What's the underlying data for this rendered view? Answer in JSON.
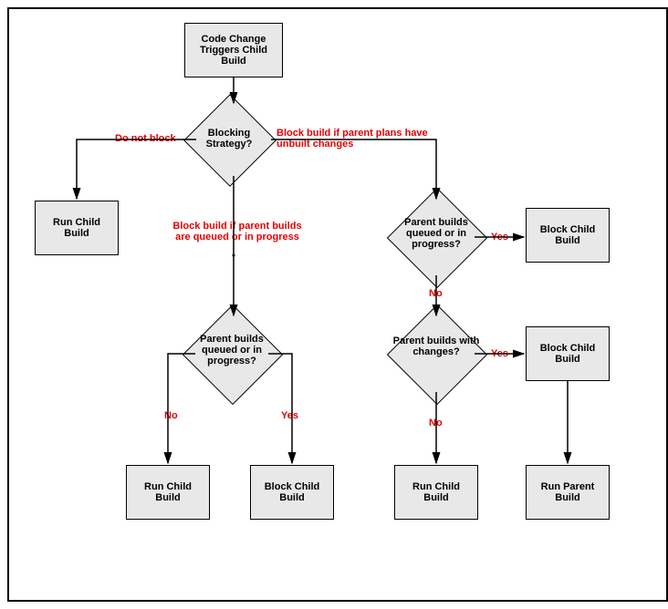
{
  "chart_data": {
    "type": "flowchart",
    "nodes": [
      {
        "id": "start",
        "shape": "rect",
        "text": "Code Change Triggers Child Build"
      },
      {
        "id": "d_strategy",
        "shape": "diamond",
        "text": "Blocking Strategy?"
      },
      {
        "id": "run_child_left",
        "shape": "rect",
        "text": "Run Child Build"
      },
      {
        "id": "d_parent_qp_left",
        "shape": "diamond",
        "text": "Parent builds queued or in progress?"
      },
      {
        "id": "run_child_mid1",
        "shape": "rect",
        "text": "Run Child Build"
      },
      {
        "id": "block_child_mid",
        "shape": "rect",
        "text": "Block Child Build"
      },
      {
        "id": "d_parent_qp_right",
        "shape": "diamond",
        "text": "Parent builds queued or in progress?"
      },
      {
        "id": "block_child_r1",
        "shape": "rect",
        "text": "Block Child Build"
      },
      {
        "id": "d_parent_changes",
        "shape": "diamond",
        "text": "Parent builds with changes?"
      },
      {
        "id": "block_child_r2",
        "shape": "rect",
        "text": "Block Child Build"
      },
      {
        "id": "run_child_r",
        "shape": "rect",
        "text": "Run Child Build"
      },
      {
        "id": "run_parent",
        "shape": "rect",
        "text": "Run Parent Build"
      }
    ],
    "edges": [
      {
        "from": "start",
        "to": "d_strategy",
        "label": ""
      },
      {
        "from": "d_strategy",
        "to": "run_child_left",
        "label": "Do not block"
      },
      {
        "from": "d_strategy",
        "to": "d_parent_qp_left",
        "label": "Block build if parent builds are queued or in progress"
      },
      {
        "from": "d_strategy",
        "to": "d_parent_qp_right",
        "label": "Block build if parent plans have unbuilt changes"
      },
      {
        "from": "d_parent_qp_left",
        "to": "run_child_mid1",
        "label": "No"
      },
      {
        "from": "d_parent_qp_left",
        "to": "block_child_mid",
        "label": "Yes"
      },
      {
        "from": "d_parent_qp_right",
        "to": "block_child_r1",
        "label": "Yes"
      },
      {
        "from": "d_parent_qp_right",
        "to": "d_parent_changes",
        "label": "No"
      },
      {
        "from": "d_parent_changes",
        "to": "block_child_r2",
        "label": "Yes"
      },
      {
        "from": "d_parent_changes",
        "to": "run_child_r",
        "label": "No"
      },
      {
        "from": "block_child_r2",
        "to": "run_parent",
        "label": ""
      }
    ]
  },
  "nodes": {
    "start": "Code Change Triggers Child Build",
    "d_strategy": "Blocking Strategy?",
    "run_child_left": "Run Child Build",
    "d_parent_qp_left": "Parent builds queued or in progress?",
    "run_child_mid1": "Run Child Build",
    "block_child_mid": "Block Child Build",
    "d_parent_qp_right": "Parent builds queued or in progress?",
    "block_child_r1": "Block Child Build",
    "d_parent_changes": "Parent builds with changes?",
    "block_child_r2": "Block Child Build",
    "run_child_r": "Run Child Build",
    "run_parent": "Run Parent Build"
  },
  "labels": {
    "do_not_block": "Do not block",
    "block_unbuilt": "Block build if parent plans have unbuilt changes",
    "block_queued": "Block build if parent builds are queued or in progress",
    "no1": "No",
    "yes1": "Yes",
    "yes2": "Yes",
    "no2": "No",
    "yes3": "Yes",
    "no3": "No"
  }
}
